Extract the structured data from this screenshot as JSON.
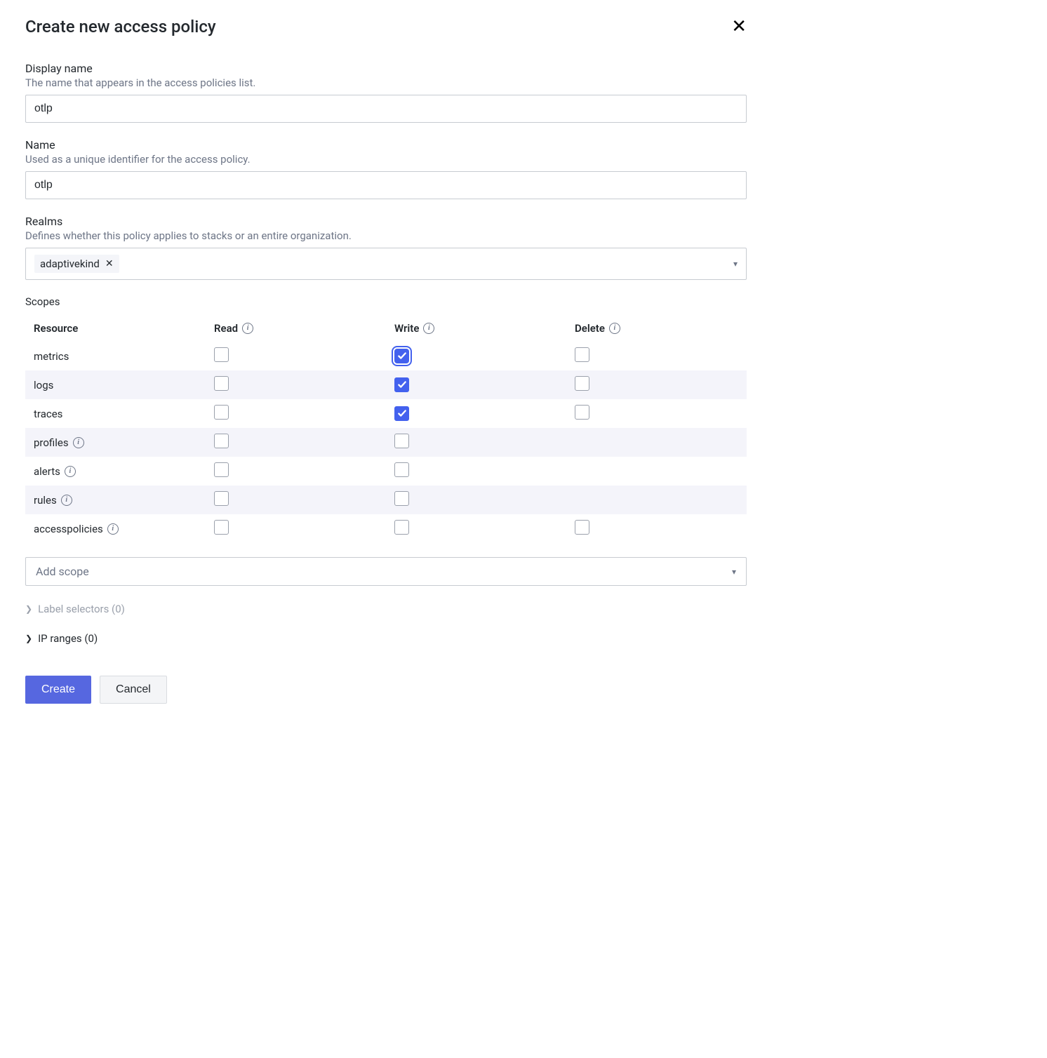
{
  "dialog": {
    "title": "Create new access policy"
  },
  "fields": {
    "display_name": {
      "label": "Display name",
      "help": "The name that appears in the access policies list.",
      "value": "otlp"
    },
    "name": {
      "label": "Name",
      "help": "Used as a unique identifier for the access policy.",
      "value": "otlp"
    },
    "realms": {
      "label": "Realms",
      "help": "Defines whether this policy applies to stacks or an entire organization.",
      "chip": "adaptivekind"
    }
  },
  "scopes": {
    "label": "Scopes",
    "headers": {
      "resource": "Resource",
      "read": "Read",
      "write": "Write",
      "delete": "Delete"
    },
    "rows": [
      {
        "name": "metrics",
        "info": false,
        "read": false,
        "write": true,
        "write_focused": true,
        "delete": false,
        "has_delete": true
      },
      {
        "name": "logs",
        "info": false,
        "read": false,
        "write": true,
        "write_focused": false,
        "delete": false,
        "has_delete": true
      },
      {
        "name": "traces",
        "info": false,
        "read": false,
        "write": true,
        "write_focused": false,
        "delete": false,
        "has_delete": true
      },
      {
        "name": "profiles",
        "info": true,
        "read": false,
        "write": false,
        "write_focused": false,
        "delete": false,
        "has_delete": false
      },
      {
        "name": "alerts",
        "info": true,
        "read": false,
        "write": false,
        "write_focused": false,
        "delete": false,
        "has_delete": false
      },
      {
        "name": "rules",
        "info": true,
        "read": false,
        "write": false,
        "write_focused": false,
        "delete": false,
        "has_delete": false
      },
      {
        "name": "accesspolicies",
        "info": true,
        "read": false,
        "write": false,
        "write_focused": false,
        "delete": false,
        "has_delete": true
      }
    ],
    "add_scope_placeholder": "Add scope"
  },
  "accordions": {
    "label_selectors": "Label selectors (0)",
    "ip_ranges": "IP ranges (0)"
  },
  "buttons": {
    "create": "Create",
    "cancel": "Cancel"
  }
}
